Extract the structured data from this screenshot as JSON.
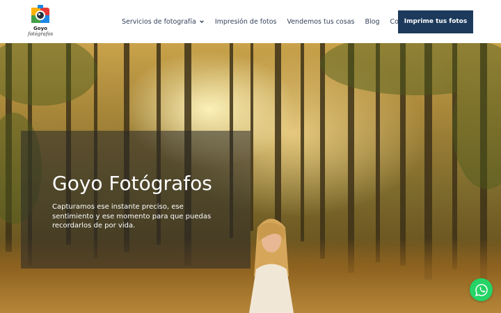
{
  "brand": {
    "name_line1": "Goyo",
    "name_line2": "fotógrafos"
  },
  "nav": {
    "items": [
      {
        "label": "Servicios de fotografía",
        "has_dropdown": true
      },
      {
        "label": "Impresión de fotos"
      },
      {
        "label": "Vendemos tus cosas"
      },
      {
        "label": "Blog"
      },
      {
        "label": "Contacto"
      }
    ],
    "cta_label": "Imprime tus fotos"
  },
  "hero": {
    "title": "Goyo Fotógrafos",
    "text": "Capturamos ese instante preciso, ese sentimiento y ese momento para que puedas recordarlos de por vida."
  },
  "colors": {
    "cta_bg": "#1d3a5c",
    "nav_text": "#33415a",
    "whatsapp": "#25d366"
  },
  "icons": {
    "dropdown": "chevron-down-icon",
    "whatsapp": "whatsapp-icon",
    "logo": "camera-logo-icon"
  }
}
